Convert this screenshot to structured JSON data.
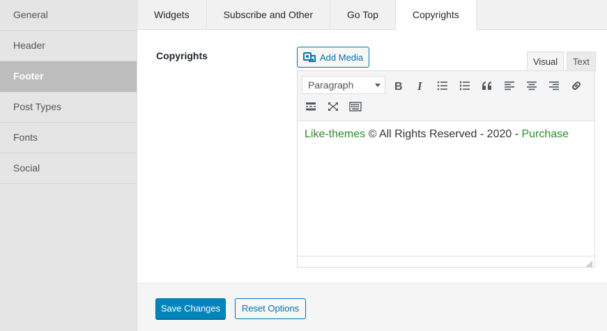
{
  "sidebar": {
    "items": [
      {
        "label": "General"
      },
      {
        "label": "Header"
      },
      {
        "label": "Footer",
        "active": true
      },
      {
        "label": "Post Types"
      },
      {
        "label": "Fonts"
      },
      {
        "label": "Social"
      }
    ]
  },
  "tabs": [
    {
      "label": "Widgets"
    },
    {
      "label": "Subscribe and Other"
    },
    {
      "label": "Go Top"
    },
    {
      "label": "Copyrights",
      "active": true
    }
  ],
  "field": {
    "label": "Copyrights"
  },
  "editor": {
    "add_media_label": "Add Media",
    "mode_visual": "Visual",
    "mode_text": "Text",
    "format_select_value": "Paragraph",
    "toolbar_icons": [
      "bold-icon",
      "italic-icon",
      "bulleted-list-icon",
      "numbered-list-icon",
      "blockquote-icon",
      "align-left-icon",
      "align-center-icon",
      "align-right-icon",
      "link-icon",
      "read-more-icon",
      "fullscreen-icon",
      "toolbar-toggle-icon"
    ],
    "content": {
      "link1": "Like-themes",
      "middle": " © All Rights Reserved - 2020 - ",
      "link2": "Purchase"
    }
  },
  "footer": {
    "save_label": "Save Changes",
    "reset_label": "Reset Options"
  },
  "colors": {
    "accent": "#0085ba",
    "link_green": "#2e8b2e",
    "sidebar_active": "#bdbdbd"
  }
}
